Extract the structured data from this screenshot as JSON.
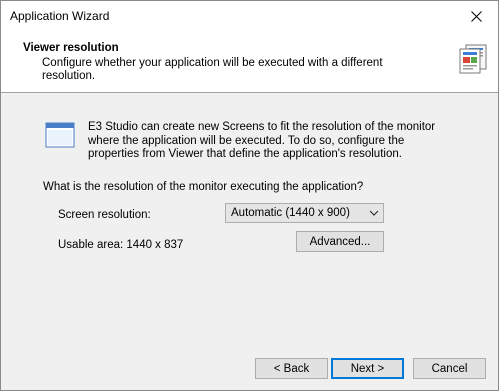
{
  "window": {
    "title": "Application Wizard"
  },
  "header": {
    "title": "Viewer resolution",
    "subtitle": "Configure whether your application will be executed with a different resolution."
  },
  "info": {
    "text": "E3 Studio can create new Screens to fit the resolution of the monitor where the application will be executed. To do so, configure the properties from Viewer that define the application's resolution."
  },
  "question": "What is the resolution of the monitor executing the application?",
  "screen_resolution": {
    "label": "Screen resolution:",
    "selected": "Automatic (1440 x 900)"
  },
  "usable_area": {
    "text": "Usable area: 1440 x 837"
  },
  "buttons": {
    "advanced": "Advanced...",
    "back": "< Back",
    "next": "Next >",
    "cancel": "Cancel"
  },
  "colors": {
    "accent": "#0078d7",
    "panel": "#f0f0f0",
    "header_bg": "#ffffff"
  }
}
